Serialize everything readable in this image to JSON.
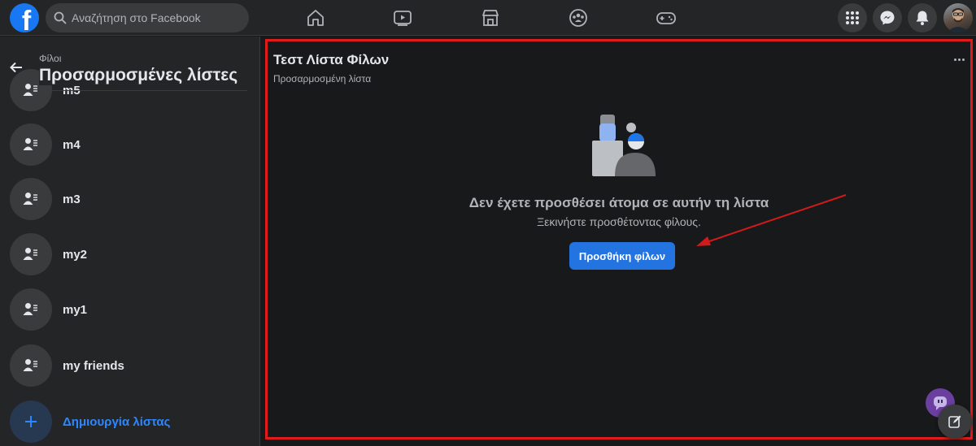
{
  "topbar": {
    "search_placeholder": "Αναζήτηση στο Facebook",
    "logo_letter": "f",
    "nav_icons": [
      "home-icon",
      "watch-icon",
      "marketplace-icon",
      "groups-icon",
      "gaming-icon"
    ],
    "right_icons": [
      "menu-grid-icon",
      "messenger-icon",
      "notifications-icon",
      "profile-avatar"
    ]
  },
  "sidebar": {
    "breadcrumb": "Φίλοι",
    "title": "Προσαρμοσμένες λίστες",
    "lists": [
      {
        "label": "m5"
      },
      {
        "label": "m4"
      },
      {
        "label": "m3"
      },
      {
        "label": "my2"
      },
      {
        "label": "my1"
      },
      {
        "label": "my friends"
      }
    ],
    "create_label": "Δημιουργία λίστας"
  },
  "main": {
    "title": "Τεστ Λίστα Φίλων",
    "subtitle": "Προσαρμοσμένη λίστα",
    "empty_title": "Δεν έχετε προσθέσει άτομα σε αυτήν τη λίστα",
    "empty_subtitle": "Ξεκινήστε προσθέτοντας φίλους.",
    "add_button": "Προσθήκη φίλων"
  },
  "colors": {
    "accent": "#2374e1",
    "highlight_border": "#e01b1b",
    "annotation_arrow": "#d11a1a",
    "background": "#18191a",
    "surface": "#242526"
  }
}
